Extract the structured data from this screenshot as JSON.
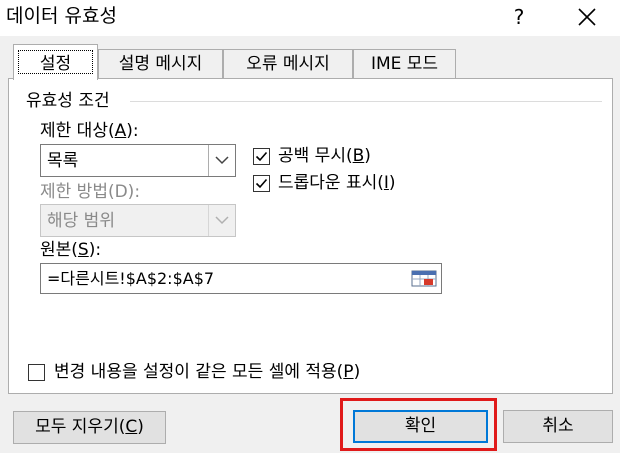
{
  "window": {
    "title": "데이터 유효성",
    "help_label": "?"
  },
  "tabs": [
    {
      "label": "설정",
      "active": true
    },
    {
      "label": "설명 메시지",
      "active": false
    },
    {
      "label": "오류 메시지",
      "active": false
    },
    {
      "label": "IME 모드",
      "active": false
    }
  ],
  "criteria": {
    "group_title": "유효성 조건",
    "allow": {
      "label_prefix": "제한 대상(",
      "label_key": "A",
      "label_suffix": "):",
      "value": "목록"
    },
    "data": {
      "label": "제한 방법(D):",
      "value": "해당 범위",
      "enabled": false
    },
    "ignore_blank": {
      "label_prefix": "공백 무시(",
      "label_key": "B",
      "label_suffix": ")",
      "checked": true
    },
    "in_cell_dropdown": {
      "label_prefix": "드롭다운 표시(",
      "label_key": "I",
      "label_suffix": ")",
      "checked": true
    },
    "source": {
      "label_prefix": "원본(",
      "label_key": "S",
      "label_suffix": "):",
      "value": "=다른시트!$A$2:$A$7"
    }
  },
  "apply_all": {
    "label_prefix": "변경 내용을 설정이 같은 모든 셀에 적용(",
    "label_key": "P",
    "label_suffix": ")",
    "checked": false
  },
  "buttons": {
    "clear_all": {
      "label_prefix": "모두 지우기(",
      "label_key": "C",
      "label_suffix": ")"
    },
    "ok": "확인",
    "cancel": "취소"
  },
  "colors": {
    "highlight": "#e01a1a",
    "focus_border": "#0078d7"
  }
}
